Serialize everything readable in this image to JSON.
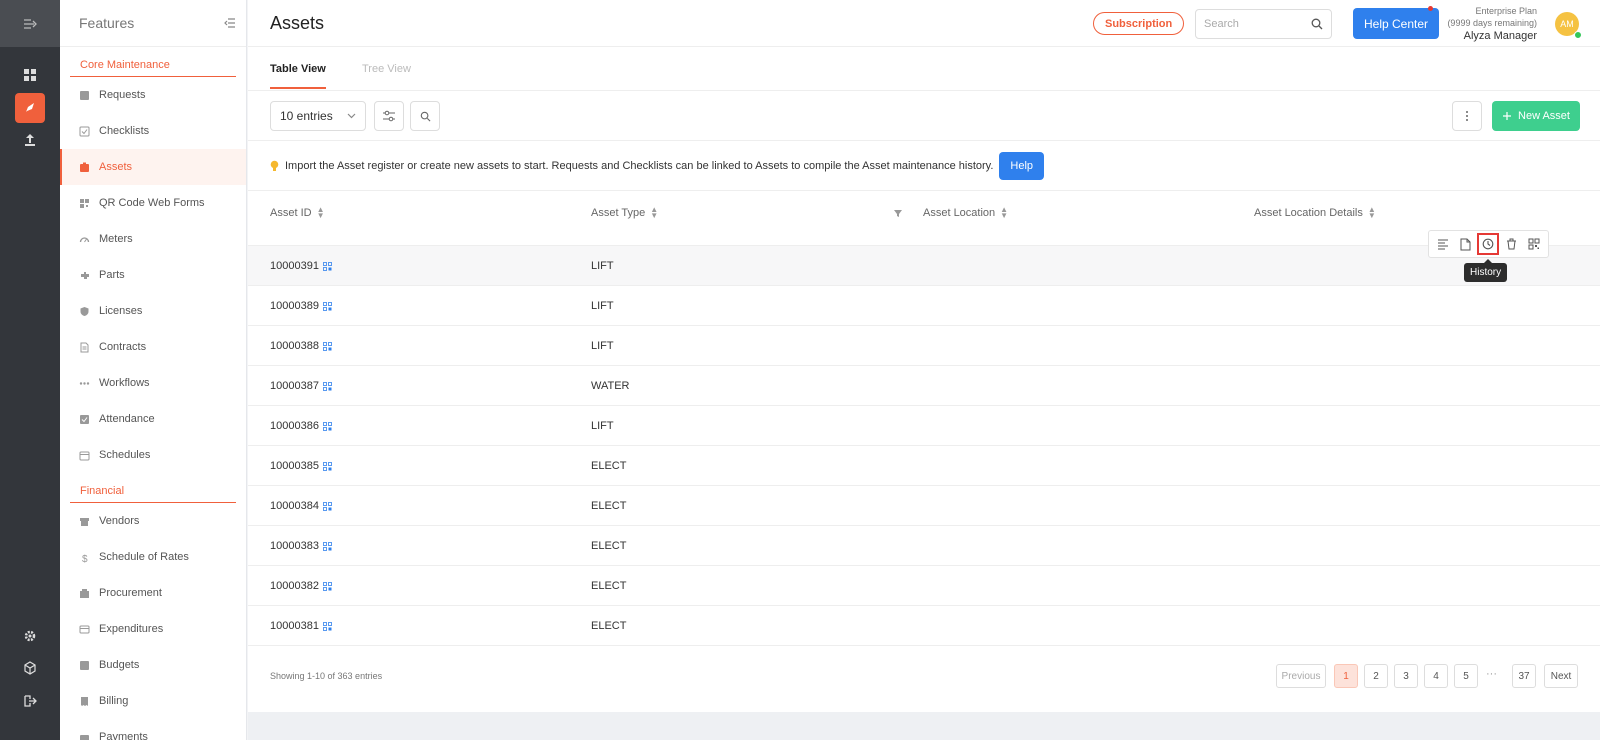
{
  "sidebar": {
    "title": "Features",
    "sections": [
      {
        "label": "Core Maintenance"
      },
      {
        "label": "Financial"
      }
    ],
    "core_items": [
      {
        "label": "Requests",
        "icon": "request-icon"
      },
      {
        "label": "Checklists",
        "icon": "checklist-icon"
      },
      {
        "label": "Assets",
        "icon": "asset-icon",
        "active": true
      },
      {
        "label": "QR Code Web Forms",
        "icon": "qr-icon"
      },
      {
        "label": "Meters",
        "icon": "meter-icon"
      },
      {
        "label": "Parts",
        "icon": "parts-icon"
      },
      {
        "label": "Licenses",
        "icon": "license-icon"
      },
      {
        "label": "Contracts",
        "icon": "contract-icon"
      },
      {
        "label": "Workflows",
        "icon": "workflow-icon"
      },
      {
        "label": "Attendance",
        "icon": "attendance-icon"
      },
      {
        "label": "Schedules",
        "icon": "schedule-icon"
      }
    ],
    "financial_items": [
      {
        "label": "Vendors",
        "icon": "vendor-icon"
      },
      {
        "label": "Schedule of Rates",
        "icon": "dollar-icon"
      },
      {
        "label": "Procurement",
        "icon": "procurement-icon"
      },
      {
        "label": "Expenditures",
        "icon": "expenditure-icon"
      },
      {
        "label": "Budgets",
        "icon": "budget-icon"
      },
      {
        "label": "Billing",
        "icon": "billing-icon"
      },
      {
        "label": "Payments",
        "icon": "payment-icon"
      }
    ]
  },
  "header": {
    "title": "Assets",
    "subscription_label": "Subscription",
    "search_placeholder": "Search",
    "help_center_label": "Help Center",
    "plan_name": "Enterprise Plan",
    "plan_remaining": "(9999 days remaining)",
    "user_name": "Alyza Manager",
    "avatar_initials": "AM"
  },
  "tabs": [
    {
      "label": "Table View",
      "active": true
    },
    {
      "label": "Tree View",
      "active": false
    }
  ],
  "toolbar": {
    "entries_label": "10 entries",
    "new_asset_label": "New Asset"
  },
  "banner": {
    "text": "Import the Asset register or create new assets to start. Requests and Checklists can be linked to Assets to compile the Asset maintenance history.",
    "help_label": "Help"
  },
  "table": {
    "columns": [
      "Asset ID",
      "Asset Type",
      "Asset Location",
      "Asset Location Details"
    ],
    "rows": [
      {
        "id": "10000391",
        "type": "LIFT"
      },
      {
        "id": "10000389",
        "type": "LIFT"
      },
      {
        "id": "10000388",
        "type": "LIFT"
      },
      {
        "id": "10000387",
        "type": "WATER"
      },
      {
        "id": "10000386",
        "type": "LIFT"
      },
      {
        "id": "10000385",
        "type": "ELECT"
      },
      {
        "id": "10000384",
        "type": "ELECT"
      },
      {
        "id": "10000383",
        "type": "ELECT"
      },
      {
        "id": "10000382",
        "type": "ELECT"
      },
      {
        "id": "10000381",
        "type": "ELECT"
      }
    ],
    "tooltip": "History"
  },
  "pagination": {
    "showing_text": "Showing 1-10 of 363 entries",
    "previous_label": "Previous",
    "pages": [
      "1",
      "2",
      "3",
      "4",
      "5"
    ],
    "ellipsis": "···",
    "last_page": "37",
    "next_label": "Next",
    "current": "1"
  },
  "colors": {
    "accent": "#f0603c",
    "primary": "#2f80ed",
    "success": "#3ecf8e",
    "rail": "#33363b"
  }
}
